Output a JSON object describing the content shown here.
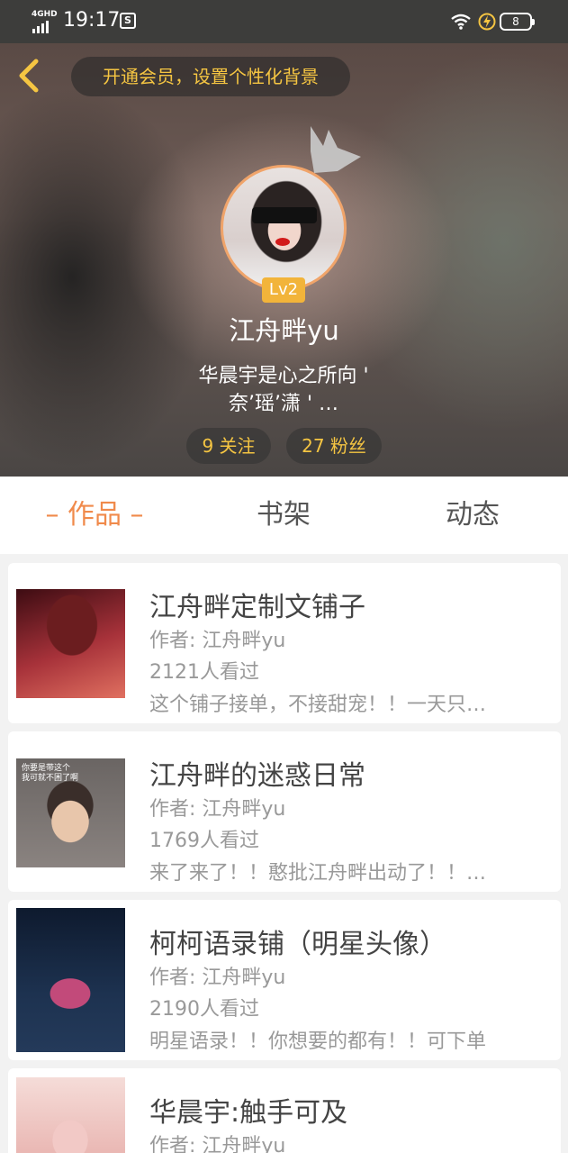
{
  "status_bar": {
    "network": "4GHD",
    "time": "19:17",
    "app_icon": "S",
    "battery": "8"
  },
  "header": {
    "vip_banner": "开通会员，设置个性化背景",
    "nickname": "江舟畔yu",
    "level": "Lv2",
    "bio_line1": "华晨宇是心之所向 '",
    "bio_line2": "奈’瑶’潇 ' …",
    "following": "9 关注",
    "fans": "27 粉丝",
    "accent_color": "#f5c542"
  },
  "tabs": [
    {
      "label": "– 作品 –",
      "active": true
    },
    {
      "label": "书架",
      "active": false
    },
    {
      "label": "动态",
      "active": false
    }
  ],
  "works": [
    {
      "title": "江舟畔定制文铺子",
      "author": "作者: 江舟畔yu",
      "views": "2121人看过",
      "desc": "这个铺子接单，不接甜宠！！一天只…"
    },
    {
      "title": "江舟畔的迷惑日常",
      "author": "作者: 江舟畔yu",
      "views": "1769人看过",
      "desc": "来了来了！！憨批江舟畔出动了！！…",
      "cover_text": "你要是带这个\n我可就不困了啊"
    },
    {
      "title": "柯柯语录铺（明星头像）",
      "author": "作者: 江舟畔yu",
      "views": "2190人看过",
      "desc": "明星语录！！你想要的都有！！可下单"
    },
    {
      "title": "华晨宇:触手可及",
      "author": "作者: 江舟畔yu"
    }
  ]
}
